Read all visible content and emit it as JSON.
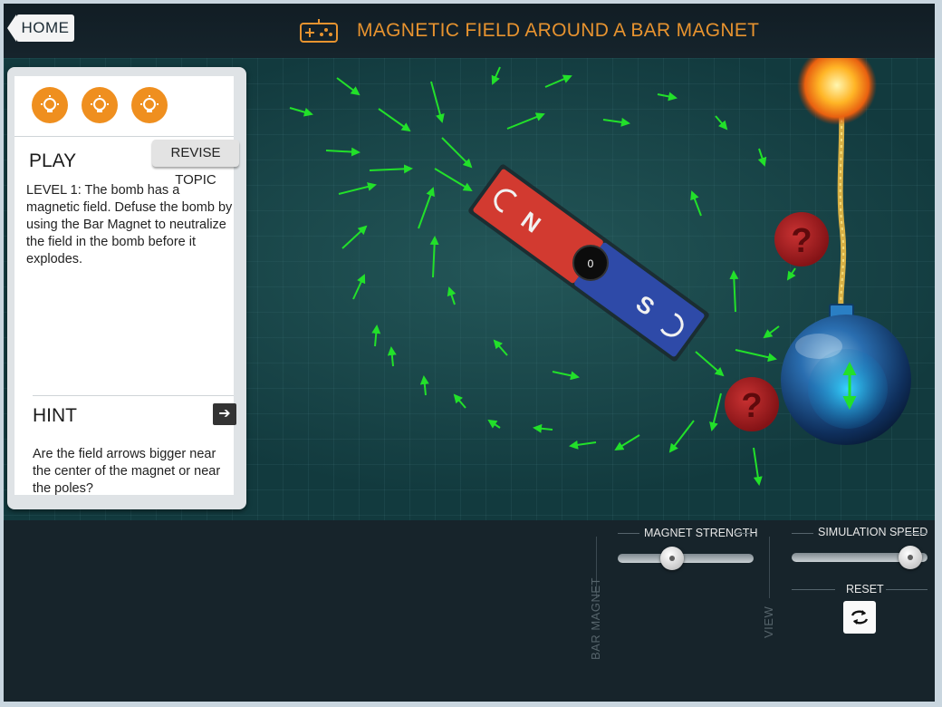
{
  "header": {
    "home_label": "HOME",
    "title": "MAGNETIC FIELD AROUND A BAR MAGNET",
    "icon": "gamepad-icon"
  },
  "panel": {
    "bulbs": [
      "lightbulb-icon",
      "lightbulb-icon",
      "lightbulb-icon"
    ],
    "play_heading": "PLAY",
    "revise_label": "REVISE TOPIC",
    "level_text": "LEVEL 1: The bomb has a magnetic field. Defuse the bomb by using the Bar Magnet to neutralize the field in the bomb before it explodes.",
    "hint_heading": "HINT",
    "hint_icon": "arrow-right-icon",
    "hint_text": "Are the field arrows bigger near the center of the magnet or near the poles?"
  },
  "magnet": {
    "north_label": "N",
    "south_label": "S",
    "center_value": "0"
  },
  "bomb": {
    "mystery_labels": [
      "?",
      "?"
    ]
  },
  "controls": {
    "magnet_strength_label": "MAGNET STRENGTH",
    "magnet_strength": 0.4,
    "simulation_speed_label": "SIMULATION SPEED",
    "simulation_speed": 0.87,
    "reset_label": "RESET",
    "bar_magnet_label": "BAR MAGNET",
    "view_label": "VIEW"
  },
  "colors": {
    "accent": "#e7932f",
    "north": "#d23a30",
    "south": "#2e4aa8",
    "field_arrow": "#22e02a"
  }
}
